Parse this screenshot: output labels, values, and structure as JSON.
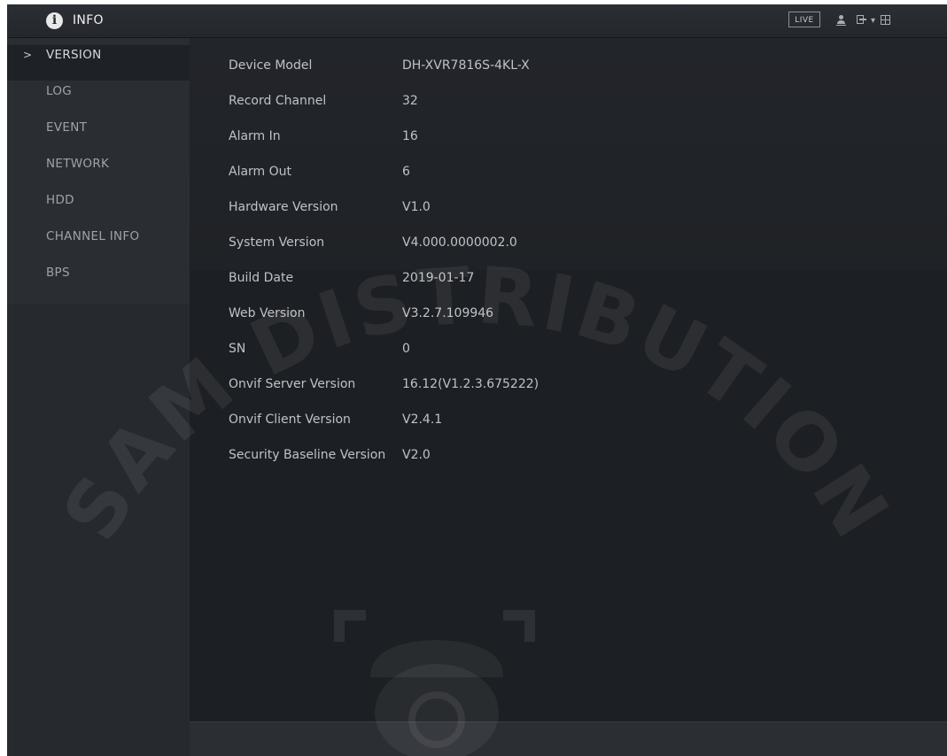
{
  "header": {
    "icon": "info-icon",
    "title": "INFO",
    "live_label": "LIVE",
    "menu_glyph": "▾"
  },
  "sidebar": {
    "active_chevron": ">",
    "items": [
      {
        "label": "VERSION",
        "active": true
      },
      {
        "label": "LOG",
        "active": false
      },
      {
        "label": "EVENT",
        "active": false
      },
      {
        "label": "NETWORK",
        "active": false
      },
      {
        "label": "HDD",
        "active": false
      },
      {
        "label": "CHANNEL INFO",
        "active": false
      },
      {
        "label": "BPS",
        "active": false
      }
    ]
  },
  "version_info": [
    {
      "label": "Device Model",
      "value": "DH-XVR7816S-4KL-X"
    },
    {
      "label": "Record Channel",
      "value": "32"
    },
    {
      "label": "Alarm In",
      "value": "16"
    },
    {
      "label": "Alarm Out",
      "value": "6"
    },
    {
      "label": "Hardware Version",
      "value": "V1.0"
    },
    {
      "label": "System Version",
      "value": "V4.000.0000002.0"
    },
    {
      "label": "Build Date",
      "value": "2019-01-17"
    },
    {
      "label": "Web Version",
      "value": "V3.2.7.109946"
    },
    {
      "label": "SN",
      "value": "0"
    },
    {
      "label": "Onvif Server Version",
      "value": "16.12(V1.2.3.675222)"
    },
    {
      "label": "Onvif Client Version",
      "value": "V2.4.1"
    },
    {
      "label": "Security Baseline Version",
      "value": "V2.0"
    }
  ],
  "watermark": {
    "text": "SAM DISTRIBUTION"
  },
  "colors": {
    "background": "#1e2126",
    "sidebar": "#2a2d32",
    "text": "#bfc2c6",
    "watermark": "#ffffff"
  }
}
